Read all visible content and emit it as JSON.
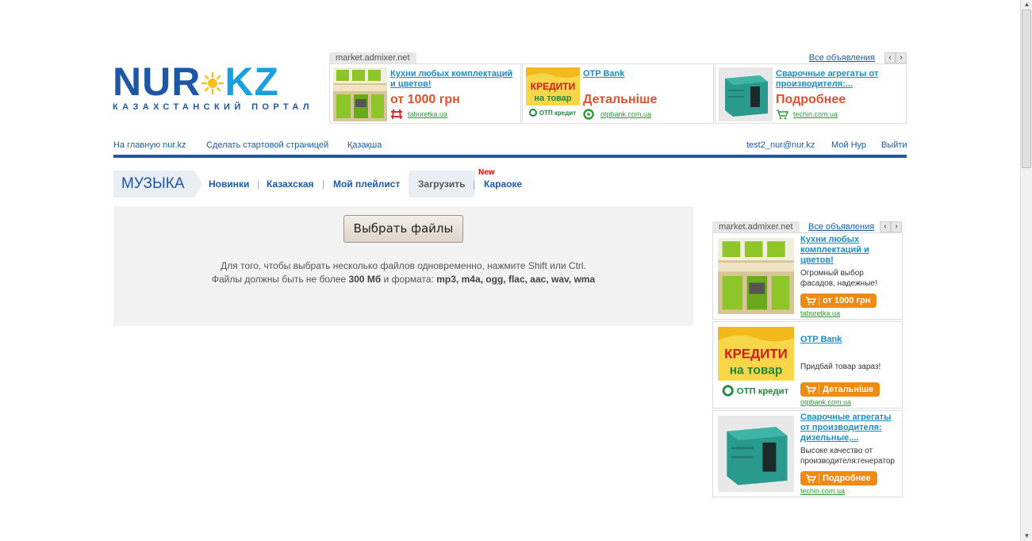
{
  "logo": {
    "main": "NUR",
    "kz": "KZ",
    "subtitle": "КАЗАХСТАНСКИЙ ПОРТАЛ"
  },
  "top_ads": {
    "source": "market.admixer.net",
    "all_label": "Все объявления",
    "prev": "‹",
    "next": "›",
    "items": [
      {
        "title": "Кухни любых комплектаций и цветов!",
        "price": "от 1000 грн",
        "domain": "taburetka.ua"
      },
      {
        "title": "OTP Bank",
        "price": "Детальніше",
        "domain": "otpbank.com.ua"
      },
      {
        "title": "Сварочные агрегаты от производителя:...",
        "price": "Подробнее",
        "domain": "techin.com.ua"
      }
    ]
  },
  "otp_banner": {
    "line1": "КРЕДИТИ",
    "line2": "на товар",
    "brand": "ОТП кредит"
  },
  "topnav": {
    "home": "На главную nur.kz",
    "start_page": "Сделать стартовой страницей",
    "kazakh": "Қазақша",
    "user": "test2_nur@nur.kz",
    "my_nur": "Мой Нур",
    "logout": "Выйти"
  },
  "section_nav": {
    "title": "МУЗЫКА",
    "new": "Новинки",
    "kazakh": "Казахская",
    "playlist": "Мой плейлист",
    "upload": "Загрузить",
    "karaoke": "Караоке",
    "new_badge": "New",
    "sep": "|"
  },
  "upload": {
    "button": "Выбрать файлы",
    "hint1": "Для того, чтобы выбрать несколько файлов одновременно, нажмите Shift или Ctrl.",
    "hint2_pre": "Файлы должны быть не более ",
    "hint2_size": "300 Мб",
    "hint2_mid": " и формата: ",
    "hint2_formats": "mp3, m4a, ogg, flac, aac, wav, wma"
  },
  "side_ads": {
    "source": "market.admixer.net",
    "all_label": "Все объявления",
    "prev": "‹",
    "next": "›",
    "items": [
      {
        "title": "Кухни любых комплектаций и цветов!",
        "desc": "Огромный выбор фасадов, надежные!",
        "button": "от 1000 грн",
        "domain": "taburetka.ua"
      },
      {
        "title": "OTP Bank",
        "desc": "Придбай товар зараз!",
        "button": "Детальніше",
        "domain": "otpbank.com.ua"
      },
      {
        "title": "Сварочные агрегаты от производителя: дизельные,...",
        "desc": "Высоке качество от производителя:генератор",
        "button": "Подробнее",
        "domain": "techin.com.ua"
      }
    ]
  },
  "scrollbar": {
    "up": "▲",
    "down": "▼"
  },
  "colors": {
    "brand_blue": "#1d57a6",
    "accent_orange": "#f08a10",
    "price_red": "#e0502a",
    "link_green": "#2e9b30"
  }
}
